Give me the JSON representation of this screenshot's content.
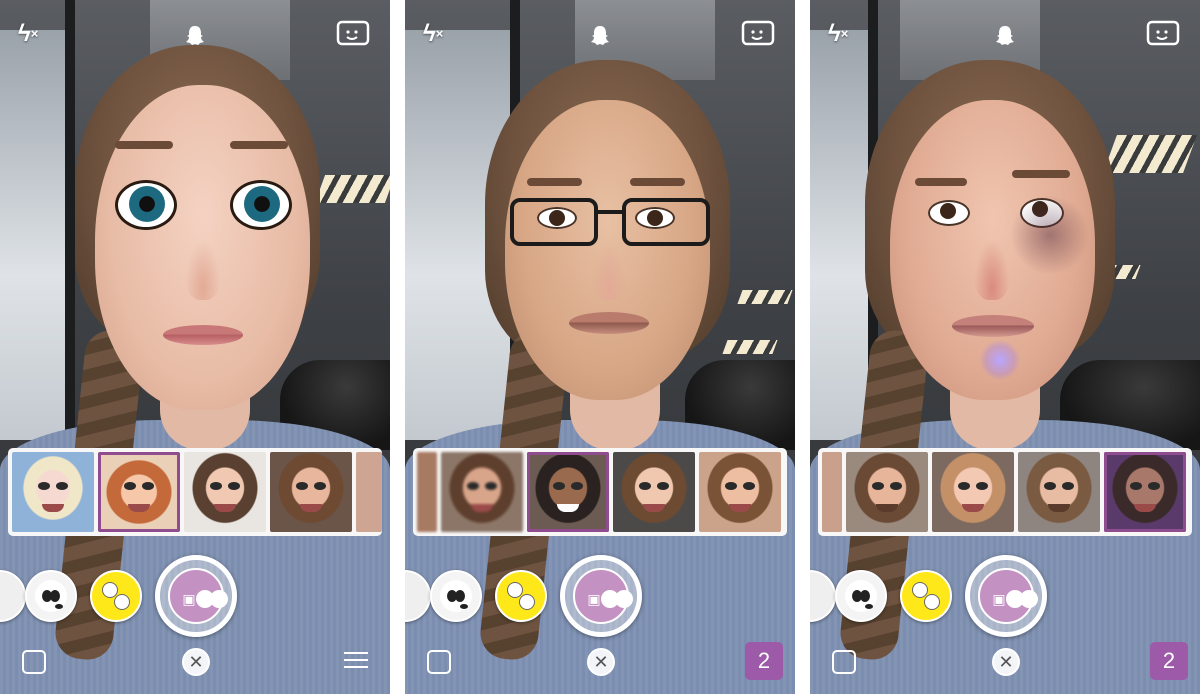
{
  "panels": [
    {
      "filter": "doll-face",
      "icons": [
        "flash-off-icon",
        "snapchat-ghost-icon",
        "flip-camera-icon"
      ],
      "lens_thumbnails": [
        "elsa-lens",
        "anna-lens",
        "face-swap-lens",
        "face-swap-lens",
        "face-swap-lens"
      ],
      "selected_lens_index": 1,
      "bottom_right": {
        "type": "stories-icon",
        "label": ""
      }
    },
    {
      "filter": "face-swap",
      "icons": [
        "flash-off-icon",
        "snapchat-ghost-icon",
        "flip-camera-icon"
      ],
      "lens_thumbnails": [
        "face-photo",
        "face-photo",
        "face-photo",
        "face-photo",
        "face-photo"
      ],
      "selected_lens_index": 2,
      "bottom_right": {
        "type": "badge",
        "label": "2"
      }
    },
    {
      "filter": "face-swap",
      "icons": [
        "flash-off-icon",
        "snapchat-ghost-icon",
        "flip-camera-icon"
      ],
      "lens_thumbnails": [
        "face-photo",
        "face-photo",
        "face-photo",
        "face-photo",
        "face-photo"
      ],
      "selected_lens_index": 4,
      "bottom_right": {
        "type": "badge",
        "label": "2"
      }
    }
  ],
  "colors": {
    "accent": "#9c5aa8",
    "shutter": "#c392c3",
    "swap_button": "#ffe81a"
  }
}
